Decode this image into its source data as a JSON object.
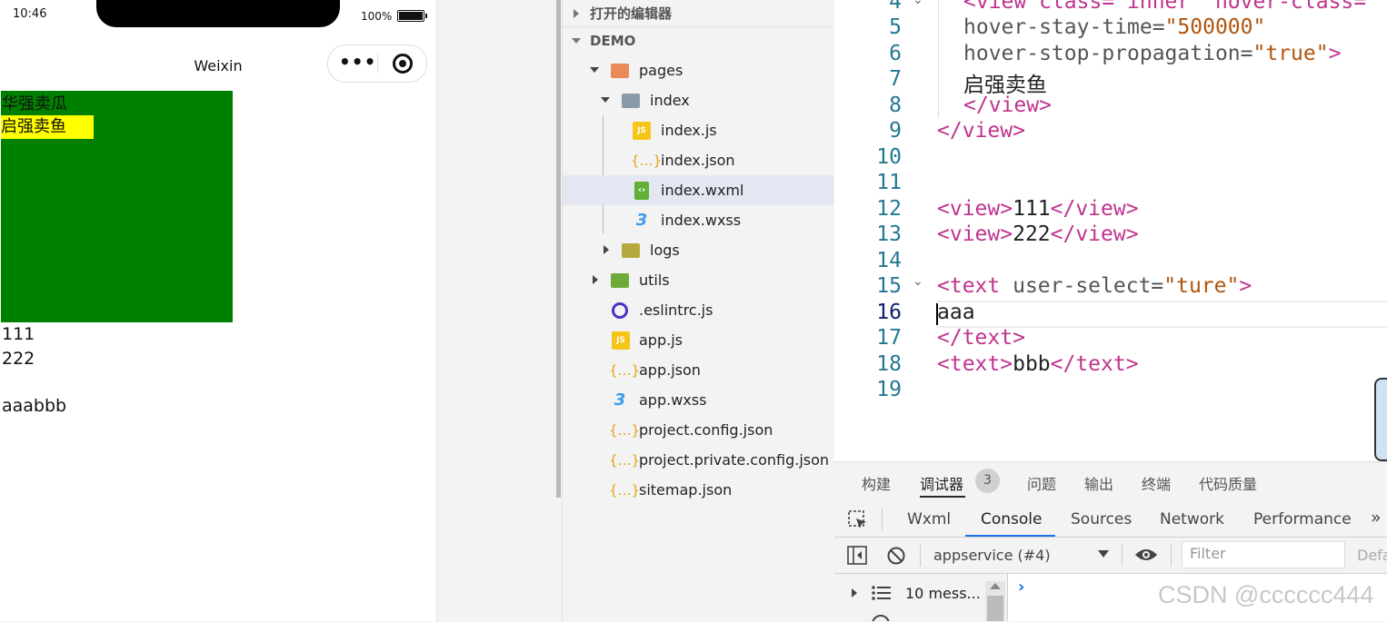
{
  "status_bar": {
    "time": "10:46",
    "battery": "100%"
  },
  "navbar": {
    "title": "Weixin"
  },
  "preview": {
    "outer_text": "华强卖瓜",
    "inner_text": "启强卖鱼",
    "line1": "111",
    "line2": "222",
    "line3": "aaabbb"
  },
  "explorer": {
    "open_editors": "打开的编辑器",
    "root": "DEMO",
    "items": [
      {
        "label": "pages"
      },
      {
        "label": "index"
      },
      {
        "label": "index.js"
      },
      {
        "label": "index.json"
      },
      {
        "label": "index.wxml"
      },
      {
        "label": "index.wxss"
      },
      {
        "label": "logs"
      },
      {
        "label": "utils"
      },
      {
        "label": ".eslintrc.js"
      },
      {
        "label": "app.js"
      },
      {
        "label": "app.json"
      },
      {
        "label": "app.wxss"
      },
      {
        "label": "project.config.json"
      },
      {
        "label": "project.private.config.json"
      },
      {
        "label": "sitemap.json"
      }
    ],
    "icon_js": "JS"
  },
  "editor": {
    "line_numbers": [
      "4",
      "5",
      "6",
      "7",
      "8",
      "9",
      "10",
      "11",
      "12",
      "13",
      "14",
      "15",
      "16",
      "17",
      "18",
      "19"
    ],
    "l4a": "<view class=\"inner\" hover-class=",
    "l5_attr": "hover-stay-time=",
    "l5_val": "\"500000\"",
    "l6_attr": "hover-stop-propagation=",
    "l6_val": "\"true\"",
    "l6_close": ">",
    "l7": "启强卖鱼",
    "l8": "</view>",
    "l9": "</view>",
    "l12_open": "<view>",
    "l12_text": "111",
    "l12_close": "</view>",
    "l13_open": "<view>",
    "l13_text": "222",
    "l13_close": "</view>",
    "l15_open": "<text",
    "l15_attr": " user-select=",
    "l15_val": "\"ture\"",
    "l15_close": ">",
    "l16": "aaa",
    "l17": "</text>",
    "l18_open": "<text>",
    "l18_text": "bbb",
    "l18_close": "</text>"
  },
  "devtools": {
    "panel_tabs": [
      "构建",
      "调试器",
      "问题",
      "输出",
      "终端",
      "代码质量"
    ],
    "badge": "3",
    "tabs": [
      "Wxml",
      "Console",
      "Sources",
      "Network",
      "Performance"
    ],
    "more": "»",
    "context": "appservice (#4)",
    "filter_placeholder": "Filter",
    "default_levels": "Defa",
    "messages": "10 mess...",
    "prompt": "›"
  },
  "watermark": "CSDN @cccccc444"
}
